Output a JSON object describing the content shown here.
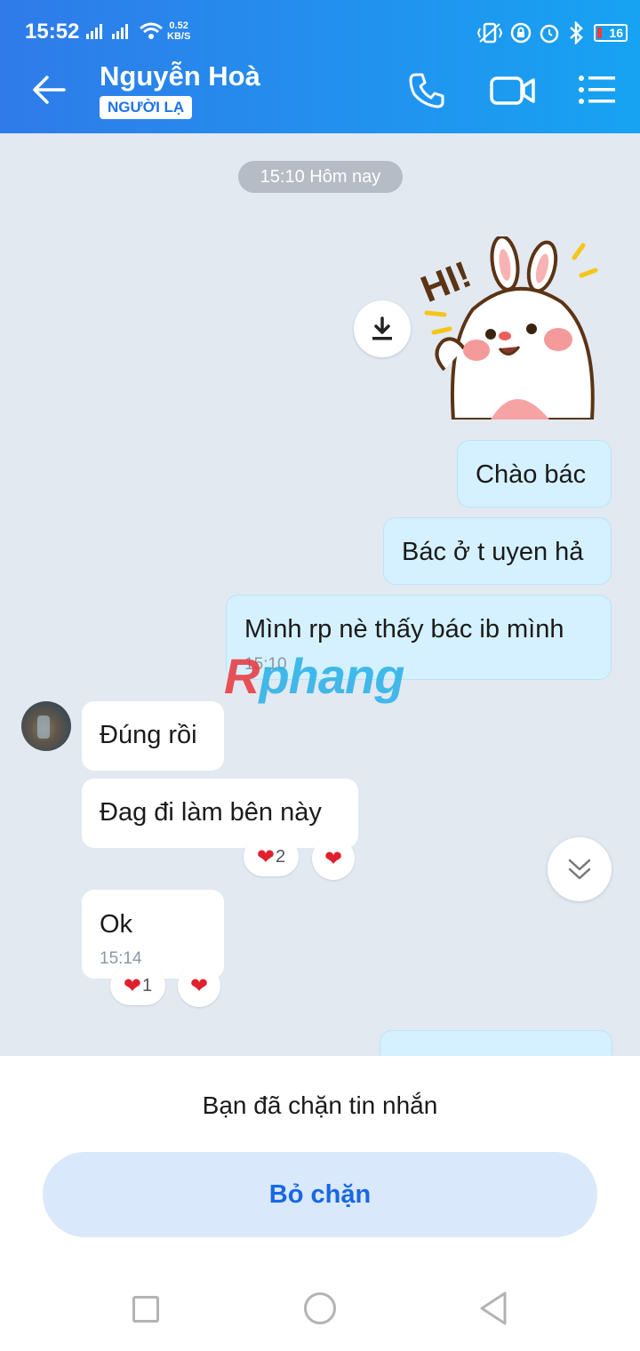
{
  "status_bar": {
    "time": "15:52",
    "net_speed_value": "0.52",
    "net_speed_unit": "KB/S",
    "battery": "16"
  },
  "header": {
    "contact_name": "Nguyễn Hoà",
    "badge": "NGƯỜI LẠ",
    "icons": [
      "back-arrow-icon",
      "phone-icon",
      "video-icon",
      "menu-icon"
    ]
  },
  "chat": {
    "date_pill": "15:10 Hôm nay",
    "sticker_text": "HI!",
    "outgoing": [
      {
        "text": "Chào bác"
      },
      {
        "text": "Bác ở t uyen hả"
      },
      {
        "text": "Mình rp nè thấy bác ib mình",
        "time": "15:10"
      }
    ],
    "incoming": [
      {
        "text": "Đúng rồi"
      },
      {
        "text": "Đag đi làm bên này",
        "reaction_count": "2"
      },
      {
        "text": "Ok",
        "time": "15:14",
        "reaction_count": "1"
      }
    ],
    "watermark": {
      "first": "R",
      "rest": "phang"
    },
    "colors": {
      "outgoing_bubble": "#d5f1ff",
      "incoming_bubble": "#ffffff",
      "header": "#2f7be9"
    }
  },
  "bottom": {
    "blocked_message": "Bạn đã chặn tin nhắn",
    "unblock_label": "Bỏ chặn"
  }
}
